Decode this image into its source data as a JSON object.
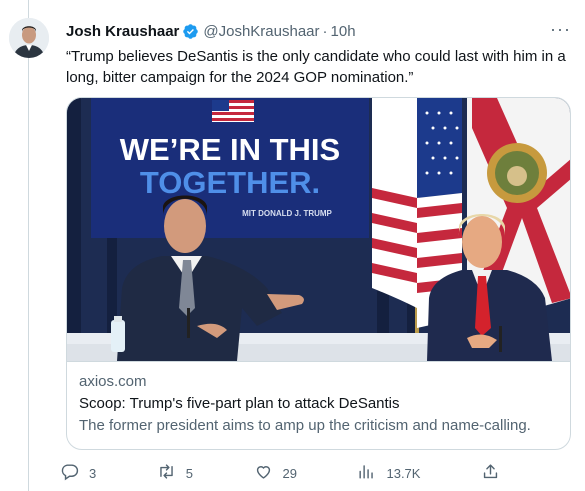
{
  "author": {
    "name": "Josh Kraushaar",
    "handle": "@JoshKraushaar",
    "separator": "·",
    "time": "10h",
    "more": "···"
  },
  "tweet": {
    "text": "“Trump believes DeSantis is the only candidate who could last with him in a long, bitter campaign for the 2024 GOP nomination.”"
  },
  "card": {
    "image": {
      "banner_line1": "WE’RE IN THIS",
      "banner_line2": "TOGETHER.",
      "banner_sub": "MIT DONALD J. TRUMP"
    },
    "domain": "axios.com",
    "headline": "Scoop: Trump's five-part plan to attack DeSantis",
    "description": "The former president aims to amp up the criticism and name-calling."
  },
  "actions": {
    "replies": "3",
    "retweets": "5",
    "likes": "29",
    "views": "13.7K"
  },
  "colors": {
    "verified": "#1d9bf0",
    "muted": "#536471",
    "text": "#0f1419",
    "border": "#cfd9de"
  },
  "icons": [
    "verified-badge-icon",
    "more-icon",
    "reply-icon",
    "retweet-icon",
    "like-icon",
    "views-icon",
    "share-icon"
  ]
}
